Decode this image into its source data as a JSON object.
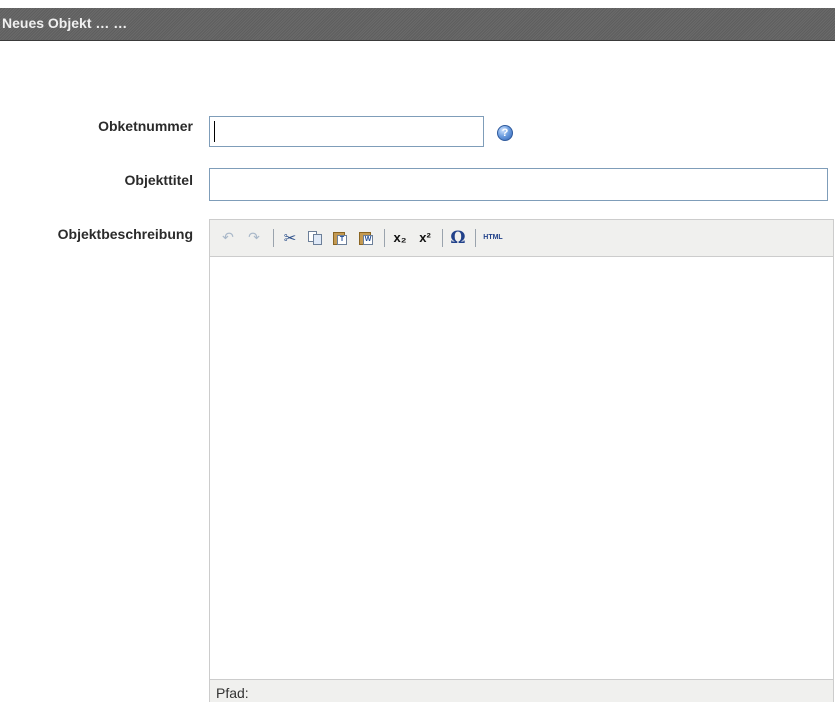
{
  "window": {
    "title": "Neues Objekt … …"
  },
  "form": {
    "objektnummer": {
      "label": "Obketnummer",
      "value": "",
      "help_icon": "help-question-icon"
    },
    "objekttitel": {
      "label": "Objekttitel",
      "value": ""
    },
    "objektbeschreibung": {
      "label": "Objektbeschreibung"
    }
  },
  "editor": {
    "toolbar": {
      "undo_icon": "↶",
      "redo_icon": "↷",
      "cut_icon": "✂",
      "paste_text_glyph": "T",
      "paste_word_glyph": "W",
      "subscript_label": "x₂",
      "superscript_label": "x²",
      "special_char_label": "Ω",
      "html_label": "HTML"
    },
    "content": "",
    "status": {
      "path_label": "Pfad:"
    }
  },
  "colors": {
    "titlebar": "#646464",
    "input_border": "#7f9db9",
    "toolbar_bg": "#f0f0ee",
    "accent_blue": "#21418a"
  }
}
